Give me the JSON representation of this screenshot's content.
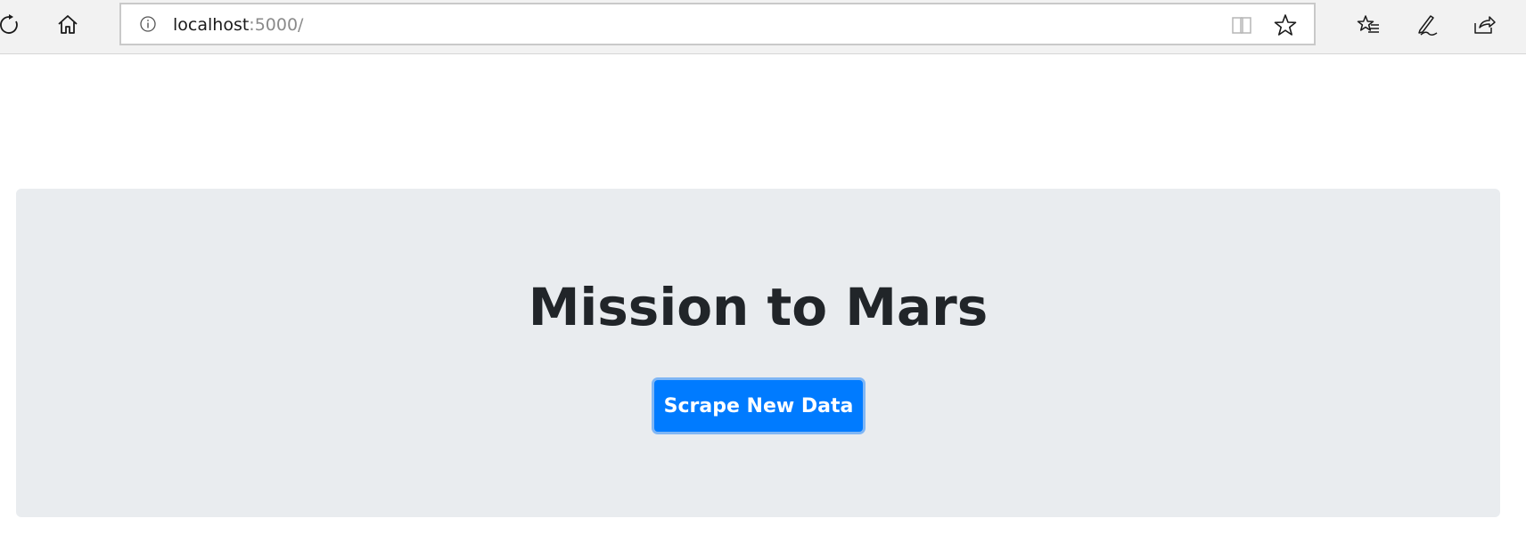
{
  "browser": {
    "address": {
      "host": "localhost",
      "rest": ":5000/"
    },
    "icons": {
      "refresh": "refresh-icon",
      "home": "home-icon",
      "info": "info-icon",
      "reading_view": "reading-view-icon",
      "favorite": "star-icon",
      "favorites_hub": "favorites-list-icon",
      "notes": "pen-icon",
      "share": "share-icon"
    }
  },
  "page": {
    "title": "Mission to Mars",
    "scrape_button_label": "Scrape New Data"
  },
  "colors": {
    "jumbotron_bg": "#e9ecef",
    "button_bg": "#007bff",
    "title_color": "#212529"
  }
}
